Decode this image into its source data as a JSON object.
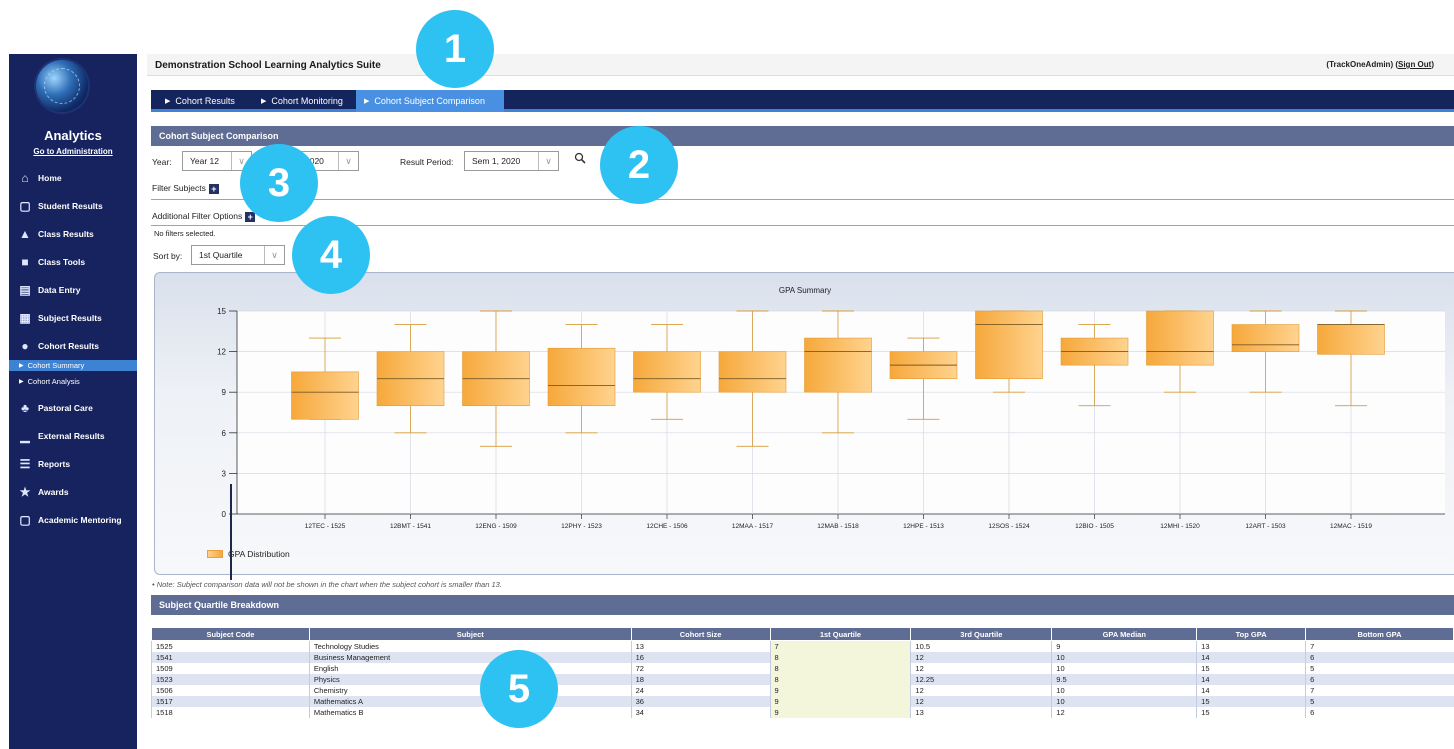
{
  "header": {
    "suite_title": "Demonstration School Learning Analytics Suite",
    "user_open": "(TrackOneAdmin) (",
    "sign_out": "Sign Out",
    "user_close": ")"
  },
  "sidebar": {
    "title": "Analytics",
    "admin_link": "Go to Administration",
    "items": [
      {
        "label": "Home",
        "icon": "home-icon"
      },
      {
        "label": "Student Results",
        "icon": "mortarboard-icon"
      },
      {
        "label": "Class Results",
        "icon": "mortarboard-icon"
      },
      {
        "label": "Class Tools",
        "icon": "briefcase-icon"
      },
      {
        "label": "Data Entry",
        "icon": "book-icon"
      },
      {
        "label": "Subject Results",
        "icon": "bookcase-icon"
      },
      {
        "label": "Cohort Results",
        "icon": "people-icon"
      },
      {
        "label": "Pastoral Care",
        "icon": "tree-icon"
      },
      {
        "label": "External Results",
        "icon": "bar-chart-icon"
      },
      {
        "label": "Reports",
        "icon": "list-icon"
      },
      {
        "label": "Awards",
        "icon": "trophy-icon"
      },
      {
        "label": "Academic Mentoring",
        "icon": "mortarboard-icon"
      }
    ],
    "subitems": [
      {
        "label": "Cohort Summary",
        "active": true
      },
      {
        "label": "Cohort Analysis",
        "active": false
      }
    ]
  },
  "tabs": [
    {
      "label": "Cohort Results",
      "active": false
    },
    {
      "label": "Cohort Monitoring",
      "active": false
    },
    {
      "label": "Cohort Subject Comparison",
      "active": true
    }
  ],
  "section_title": "Cohort Subject Comparison",
  "filters": {
    "year_label": "Year:",
    "year_value": "Year 12",
    "cal_year_value": "2020",
    "result_period_label": "Result Period:",
    "result_period_value": "Sem 1, 2020",
    "filter_subjects_label": "Filter Subjects",
    "additional_filter_label": "Additional Filter Options",
    "no_filters_text": "No filters selected.",
    "sort_label": "Sort by:",
    "sort_value": "1st Quartile"
  },
  "chart_data": {
    "type": "boxplot",
    "title": "GPA Summary",
    "ylim": [
      0,
      15
    ],
    "yticks": [
      0,
      3,
      6,
      9,
      12,
      15
    ],
    "grid": true,
    "legend": "bottom-left",
    "legend_label": "GPA Distribution",
    "categories": [
      "12TEC - 1525",
      "12BMT - 1541",
      "12ENG - 1509",
      "12PHY - 1523",
      "12CHE - 1506",
      "12MAA - 1517",
      "12MAB - 1518",
      "12HPE - 1513",
      "12SOS - 1524",
      "12BIO - 1505",
      "12MHI - 1520",
      "12ART - 1503",
      "12MAC - 1519"
    ],
    "series": [
      {
        "min": [
          7,
          6,
          5,
          6,
          7,
          5,
          6,
          7,
          9,
          8,
          9,
          9,
          8
        ],
        "q1": [
          7,
          8,
          8,
          8,
          9,
          9,
          9,
          10,
          10,
          11,
          11,
          12,
          11.8
        ],
        "median": [
          9,
          10,
          10,
          9.5,
          10,
          10,
          12,
          11,
          14,
          12,
          12,
          12.5,
          14
        ],
        "q3": [
          10.5,
          12,
          12,
          12.25,
          12,
          12,
          13,
          12,
          15,
          13,
          15,
          14,
          14
        ],
        "max": [
          13,
          14,
          15,
          14,
          14,
          15,
          15,
          13,
          15,
          14,
          15,
          15,
          15
        ]
      }
    ],
    "colors": {
      "box": "#f6a83b",
      "box_light": "#ffd38f",
      "whisker": "#d79b3a",
      "median": "#7a5a20"
    }
  },
  "note": "• Note: Subject comparison data will not be shown in the chart when the subject cohort is smaller than 13.",
  "breakdown_title": "Subject Quartile Breakdown",
  "table": {
    "columns": [
      "Subject Code",
      "Subject",
      "Cohort Size",
      "1st Quartile",
      "3rd Quartile",
      "GPA Median",
      "Top GPA",
      "Bottom GPA"
    ],
    "rows": [
      [
        "1525",
        "Technology Studies",
        "13",
        "7",
        "10.5",
        "9",
        "13",
        "7"
      ],
      [
        "1541",
        "Business Management",
        "16",
        "8",
        "12",
        "10",
        "14",
        "6"
      ],
      [
        "1509",
        "English",
        "72",
        "8",
        "12",
        "10",
        "15",
        "5"
      ],
      [
        "1523",
        "Physics",
        "18",
        "8",
        "12.25",
        "9.5",
        "14",
        "6"
      ],
      [
        "1506",
        "Chemistry",
        "24",
        "9",
        "12",
        "10",
        "14",
        "7"
      ],
      [
        "1517",
        "Mathematics A",
        "36",
        "9",
        "12",
        "10",
        "15",
        "5"
      ],
      [
        "1518",
        "Mathematics B",
        "34",
        "9",
        "13",
        "12",
        "15",
        "6"
      ]
    ]
  },
  "callouts": [
    "1",
    "2",
    "3",
    "4",
    "5"
  ]
}
